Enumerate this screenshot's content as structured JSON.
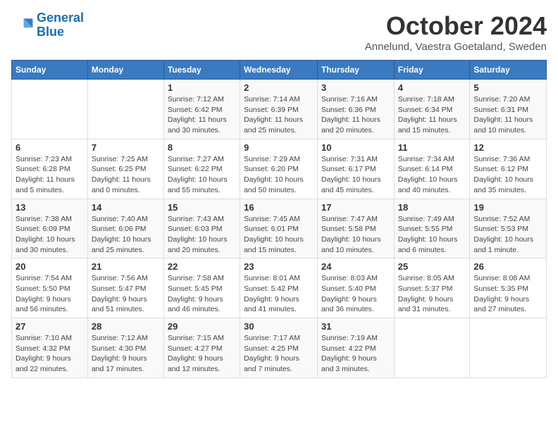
{
  "logo": {
    "line1": "General",
    "line2": "Blue"
  },
  "title": "October 2024",
  "location": "Annelund, Vaestra Goetaland, Sweden",
  "days_of_week": [
    "Sunday",
    "Monday",
    "Tuesday",
    "Wednesday",
    "Thursday",
    "Friday",
    "Saturday"
  ],
  "weeks": [
    [
      {
        "day": "",
        "sunrise": "",
        "sunset": "",
        "daylight": ""
      },
      {
        "day": "",
        "sunrise": "",
        "sunset": "",
        "daylight": ""
      },
      {
        "day": "1",
        "sunrise": "Sunrise: 7:12 AM",
        "sunset": "Sunset: 6:42 PM",
        "daylight": "Daylight: 11 hours and 30 minutes."
      },
      {
        "day": "2",
        "sunrise": "Sunrise: 7:14 AM",
        "sunset": "Sunset: 6:39 PM",
        "daylight": "Daylight: 11 hours and 25 minutes."
      },
      {
        "day": "3",
        "sunrise": "Sunrise: 7:16 AM",
        "sunset": "Sunset: 6:36 PM",
        "daylight": "Daylight: 11 hours and 20 minutes."
      },
      {
        "day": "4",
        "sunrise": "Sunrise: 7:18 AM",
        "sunset": "Sunset: 6:34 PM",
        "daylight": "Daylight: 11 hours and 15 minutes."
      },
      {
        "day": "5",
        "sunrise": "Sunrise: 7:20 AM",
        "sunset": "Sunset: 6:31 PM",
        "daylight": "Daylight: 11 hours and 10 minutes."
      }
    ],
    [
      {
        "day": "6",
        "sunrise": "Sunrise: 7:23 AM",
        "sunset": "Sunset: 6:28 PM",
        "daylight": "Daylight: 11 hours and 5 minutes."
      },
      {
        "day": "7",
        "sunrise": "Sunrise: 7:25 AM",
        "sunset": "Sunset: 6:25 PM",
        "daylight": "Daylight: 11 hours and 0 minutes."
      },
      {
        "day": "8",
        "sunrise": "Sunrise: 7:27 AM",
        "sunset": "Sunset: 6:22 PM",
        "daylight": "Daylight: 10 hours and 55 minutes."
      },
      {
        "day": "9",
        "sunrise": "Sunrise: 7:29 AM",
        "sunset": "Sunset: 6:20 PM",
        "daylight": "Daylight: 10 hours and 50 minutes."
      },
      {
        "day": "10",
        "sunrise": "Sunrise: 7:31 AM",
        "sunset": "Sunset: 6:17 PM",
        "daylight": "Daylight: 10 hours and 45 minutes."
      },
      {
        "day": "11",
        "sunrise": "Sunrise: 7:34 AM",
        "sunset": "Sunset: 6:14 PM",
        "daylight": "Daylight: 10 hours and 40 minutes."
      },
      {
        "day": "12",
        "sunrise": "Sunrise: 7:36 AM",
        "sunset": "Sunset: 6:12 PM",
        "daylight": "Daylight: 10 hours and 35 minutes."
      }
    ],
    [
      {
        "day": "13",
        "sunrise": "Sunrise: 7:38 AM",
        "sunset": "Sunset: 6:09 PM",
        "daylight": "Daylight: 10 hours and 30 minutes."
      },
      {
        "day": "14",
        "sunrise": "Sunrise: 7:40 AM",
        "sunset": "Sunset: 6:06 PM",
        "daylight": "Daylight: 10 hours and 25 minutes."
      },
      {
        "day": "15",
        "sunrise": "Sunrise: 7:43 AM",
        "sunset": "Sunset: 6:03 PM",
        "daylight": "Daylight: 10 hours and 20 minutes."
      },
      {
        "day": "16",
        "sunrise": "Sunrise: 7:45 AM",
        "sunset": "Sunset: 6:01 PM",
        "daylight": "Daylight: 10 hours and 15 minutes."
      },
      {
        "day": "17",
        "sunrise": "Sunrise: 7:47 AM",
        "sunset": "Sunset: 5:58 PM",
        "daylight": "Daylight: 10 hours and 10 minutes."
      },
      {
        "day": "18",
        "sunrise": "Sunrise: 7:49 AM",
        "sunset": "Sunset: 5:55 PM",
        "daylight": "Daylight: 10 hours and 6 minutes."
      },
      {
        "day": "19",
        "sunrise": "Sunrise: 7:52 AM",
        "sunset": "Sunset: 5:53 PM",
        "daylight": "Daylight: 10 hours and 1 minute."
      }
    ],
    [
      {
        "day": "20",
        "sunrise": "Sunrise: 7:54 AM",
        "sunset": "Sunset: 5:50 PM",
        "daylight": "Daylight: 9 hours and 56 minutes."
      },
      {
        "day": "21",
        "sunrise": "Sunrise: 7:56 AM",
        "sunset": "Sunset: 5:47 PM",
        "daylight": "Daylight: 9 hours and 51 minutes."
      },
      {
        "day": "22",
        "sunrise": "Sunrise: 7:58 AM",
        "sunset": "Sunset: 5:45 PM",
        "daylight": "Daylight: 9 hours and 46 minutes."
      },
      {
        "day": "23",
        "sunrise": "Sunrise: 8:01 AM",
        "sunset": "Sunset: 5:42 PM",
        "daylight": "Daylight: 9 hours and 41 minutes."
      },
      {
        "day": "24",
        "sunrise": "Sunrise: 8:03 AM",
        "sunset": "Sunset: 5:40 PM",
        "daylight": "Daylight: 9 hours and 36 minutes."
      },
      {
        "day": "25",
        "sunrise": "Sunrise: 8:05 AM",
        "sunset": "Sunset: 5:37 PM",
        "daylight": "Daylight: 9 hours and 31 minutes."
      },
      {
        "day": "26",
        "sunrise": "Sunrise: 8:08 AM",
        "sunset": "Sunset: 5:35 PM",
        "daylight": "Daylight: 9 hours and 27 minutes."
      }
    ],
    [
      {
        "day": "27",
        "sunrise": "Sunrise: 7:10 AM",
        "sunset": "Sunset: 4:32 PM",
        "daylight": "Daylight: 9 hours and 22 minutes."
      },
      {
        "day": "28",
        "sunrise": "Sunrise: 7:12 AM",
        "sunset": "Sunset: 4:30 PM",
        "daylight": "Daylight: 9 hours and 17 minutes."
      },
      {
        "day": "29",
        "sunrise": "Sunrise: 7:15 AM",
        "sunset": "Sunset: 4:27 PM",
        "daylight": "Daylight: 9 hours and 12 minutes."
      },
      {
        "day": "30",
        "sunrise": "Sunrise: 7:17 AM",
        "sunset": "Sunset: 4:25 PM",
        "daylight": "Daylight: 9 hours and 7 minutes."
      },
      {
        "day": "31",
        "sunrise": "Sunrise: 7:19 AM",
        "sunset": "Sunset: 4:22 PM",
        "daylight": "Daylight: 9 hours and 3 minutes."
      },
      {
        "day": "",
        "sunrise": "",
        "sunset": "",
        "daylight": ""
      },
      {
        "day": "",
        "sunrise": "",
        "sunset": "",
        "daylight": ""
      }
    ]
  ]
}
